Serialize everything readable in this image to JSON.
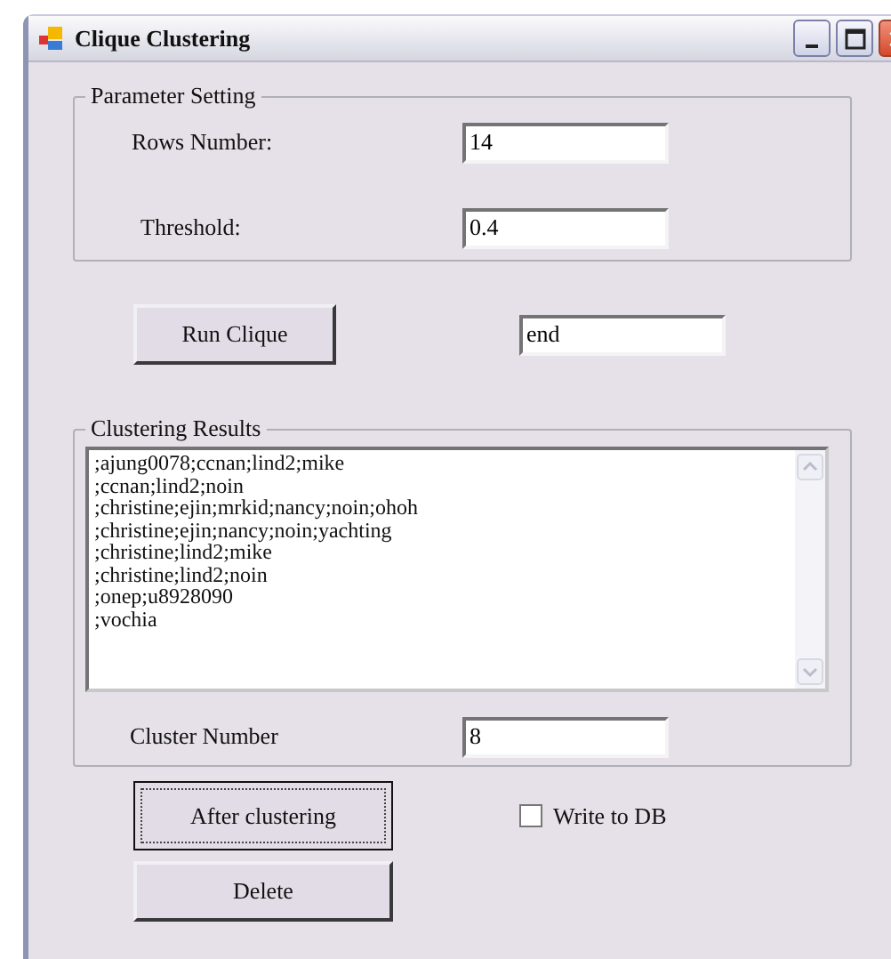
{
  "window": {
    "title": "Clique Clustering"
  },
  "parameter_setting": {
    "title": "Parameter Setting",
    "fields": [
      {
        "label": "Rows Number:",
        "value": "14"
      },
      {
        "label": "Threshold:",
        "value": "0.4"
      }
    ]
  },
  "run_button": "Run Clique",
  "status_field": {
    "value": "end"
  },
  "clustering_results": {
    "title": "Clustering Results",
    "lines": [
      ";ajung0078;ccnan;lind2;mike",
      ";ccnan;lind2;noin",
      ";christine;ejin;mrkid;nancy;noin;ohoh",
      ";christine;ejin;nancy;noin;yachting",
      ";christine;lind2;mike",
      ";christine;lind2;noin",
      ";onep;u8928090",
      ";vochia"
    ],
    "cluster_number": {
      "label": "Cluster Number",
      "value": "8"
    }
  },
  "after_button": {
    "label": "After clustering",
    "focused": true
  },
  "write_to_db": {
    "label": "Write to DB",
    "checked": false
  },
  "delete_button": "Delete"
}
